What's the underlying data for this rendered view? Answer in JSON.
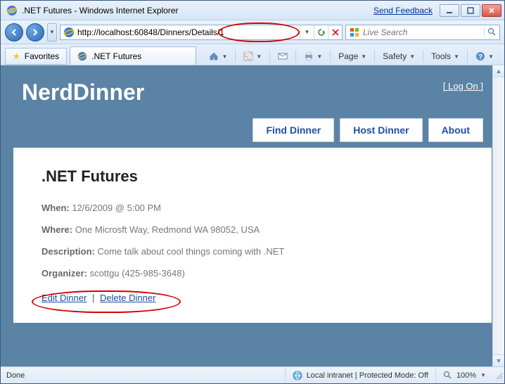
{
  "window": {
    "title": ".NET Futures - Windows Internet Explorer",
    "feedback_link": "Send Feedback"
  },
  "address_bar": {
    "url": "http://localhost:60848/Dinners/Details/1"
  },
  "search": {
    "placeholder": "Live Search"
  },
  "favorites_button": "Favorites",
  "tab": {
    "title": ".NET Futures"
  },
  "command_bar": {
    "page": "Page",
    "safety": "Safety",
    "tools": "Tools"
  },
  "page": {
    "brand": "NerdDinner",
    "logon_prefix": "[ ",
    "logon_label": "Log On",
    "logon_suffix": " ]",
    "nav": {
      "find": "Find Dinner",
      "host": "Host Dinner",
      "about": "About"
    },
    "details": {
      "title": ".NET Futures",
      "when_label": "When:",
      "when_value": "12/6/2009 @ 5:00 PM",
      "where_label": "Where:",
      "where_value": "One Microsft Way, Redmond WA 98052, USA",
      "description_label": "Description:",
      "description_value": "Come talk about cool things coming with .NET",
      "organizer_label": "Organizer:",
      "organizer_value": "scottgu (425-985-3648)"
    },
    "actions": {
      "edit": "Edit Dinner",
      "separator": "|",
      "delete": "Delete Dinner"
    }
  },
  "status": {
    "done": "Done",
    "zone": "Local intranet | Protected Mode: Off",
    "zoom": "100%"
  }
}
